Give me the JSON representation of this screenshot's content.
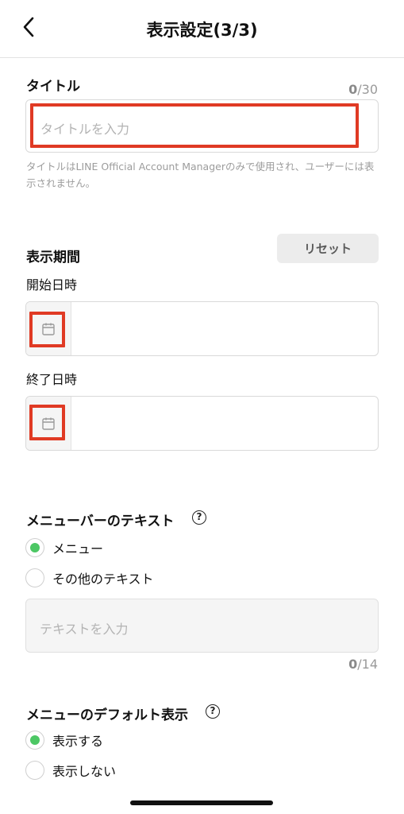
{
  "header": {
    "title": "表示設定(3/3)"
  },
  "title_section": {
    "label": "タイトル",
    "counter_current": "0",
    "counter_max": "/30",
    "placeholder": "タイトルを入力",
    "hint": "タイトルはLINE Official Account Managerのみで使用され、ユーザーには表示されません。"
  },
  "period_section": {
    "label": "表示期間",
    "reset_label": "リセット",
    "start_label": "開始日時",
    "end_label": "終了日時"
  },
  "menubar_section": {
    "label": "メニューバーのテキスト",
    "options": [
      {
        "label": "メニュー",
        "selected": true
      },
      {
        "label": "その他のテキスト",
        "selected": false
      }
    ],
    "placeholder": "テキストを入力",
    "counter_current": "0",
    "counter_max": "/14"
  },
  "default_display_section": {
    "label": "メニューのデフォルト表示",
    "options": [
      {
        "label": "表示する",
        "selected": true
      },
      {
        "label": "表示しない",
        "selected": false
      }
    ]
  },
  "colors": {
    "accent_green": "#4cc764",
    "highlight_red": "#e03a24"
  },
  "icons": {
    "back": "chevron-left-icon",
    "calendar": "calendar-icon",
    "help": "help-circle-icon"
  }
}
